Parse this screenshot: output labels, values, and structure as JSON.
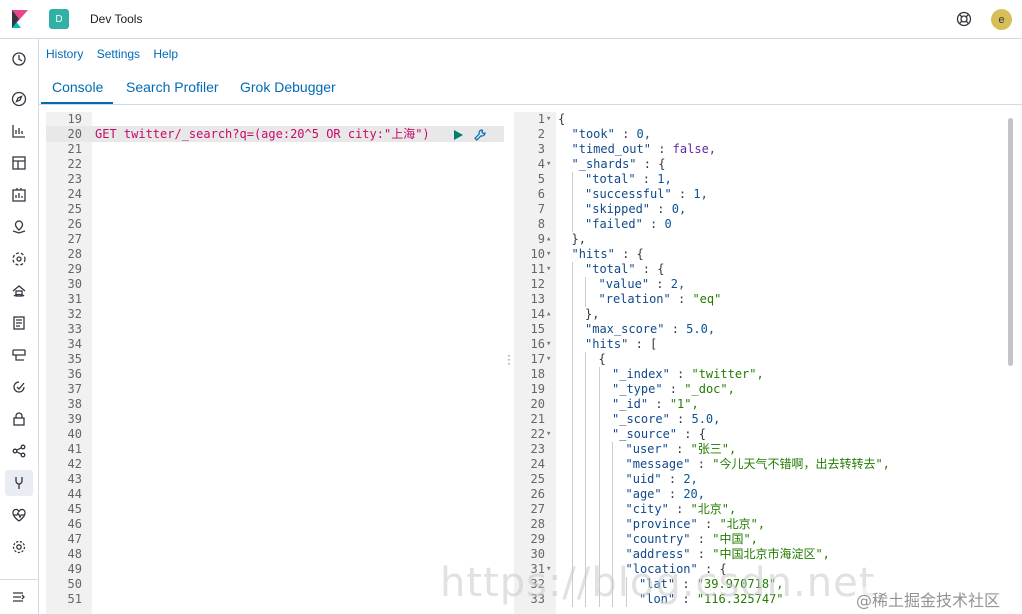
{
  "header": {
    "space_letter": "D",
    "app_title": "Dev Tools",
    "avatar_letter": "e"
  },
  "top_links": [
    "History",
    "Settings",
    "Help"
  ],
  "tabs": [
    {
      "label": "Console",
      "active": true
    },
    {
      "label": "Search Profiler",
      "active": false
    },
    {
      "label": "Grok Debugger",
      "active": false
    }
  ],
  "nav_icons": [
    "clock-icon",
    "compass-icon",
    "visualize-icon",
    "dashboard-icon",
    "canvas-icon",
    "maps-icon",
    "ml-icon",
    "infrastructure-icon",
    "logs-icon",
    "apm-icon",
    "uptime-icon",
    "siem-icon",
    "graph-icon",
    "devtools-icon",
    "monitoring-icon",
    "management-icon",
    "collapse-icon"
  ],
  "request_editor": {
    "line_numbers": [
      "19",
      "20",
      "21",
      "22",
      "23",
      "24",
      "25",
      "26",
      "27",
      "28",
      "29",
      "30",
      "31",
      "32",
      "33",
      "34",
      "35",
      "36",
      "37",
      "38",
      "39",
      "40",
      "41",
      "42",
      "43",
      "44",
      "45",
      "46",
      "47",
      "48",
      "49",
      "50",
      "51"
    ],
    "active_line": "GET twitter/_search?q=(age:20^5 OR city:\"上海\")"
  },
  "response_editor": {
    "lines": [
      {
        "n": "1",
        "fold": "▾",
        "indent": 0,
        "text": "{"
      },
      {
        "n": "2",
        "fold": "",
        "indent": 1,
        "text": "\"took\" : 0,"
      },
      {
        "n": "3",
        "fold": "",
        "indent": 1,
        "text": "\"timed_out\" : false,"
      },
      {
        "n": "4",
        "fold": "▾",
        "indent": 1,
        "text": "\"_shards\" : {"
      },
      {
        "n": "5",
        "fold": "",
        "indent": 2,
        "text": "\"total\" : 1,"
      },
      {
        "n": "6",
        "fold": "",
        "indent": 2,
        "text": "\"successful\" : 1,"
      },
      {
        "n": "7",
        "fold": "",
        "indent": 2,
        "text": "\"skipped\" : 0,"
      },
      {
        "n": "8",
        "fold": "",
        "indent": 2,
        "text": "\"failed\" : 0"
      },
      {
        "n": "9",
        "fold": "▴",
        "indent": 1,
        "text": "},"
      },
      {
        "n": "10",
        "fold": "▾",
        "indent": 1,
        "text": "\"hits\" : {"
      },
      {
        "n": "11",
        "fold": "▾",
        "indent": 2,
        "text": "\"total\" : {"
      },
      {
        "n": "12",
        "fold": "",
        "indent": 3,
        "text": "\"value\" : 2,"
      },
      {
        "n": "13",
        "fold": "",
        "indent": 3,
        "text": "\"relation\" : \"eq\""
      },
      {
        "n": "14",
        "fold": "▴",
        "indent": 2,
        "text": "},"
      },
      {
        "n": "15",
        "fold": "",
        "indent": 2,
        "text": "\"max_score\" : 5.0,"
      },
      {
        "n": "16",
        "fold": "▾",
        "indent": 2,
        "text": "\"hits\" : ["
      },
      {
        "n": "17",
        "fold": "▾",
        "indent": 3,
        "text": "{"
      },
      {
        "n": "18",
        "fold": "",
        "indent": 4,
        "text": "\"_index\" : \"twitter\","
      },
      {
        "n": "19",
        "fold": "",
        "indent": 4,
        "text": "\"_type\" : \"_doc\","
      },
      {
        "n": "20",
        "fold": "",
        "indent": 4,
        "text": "\"_id\" : \"1\","
      },
      {
        "n": "21",
        "fold": "",
        "indent": 4,
        "text": "\"_score\" : 5.0,"
      },
      {
        "n": "22",
        "fold": "▾",
        "indent": 4,
        "text": "\"_source\" : {"
      },
      {
        "n": "23",
        "fold": "",
        "indent": 5,
        "text": "\"user\" : \"张三\","
      },
      {
        "n": "24",
        "fold": "",
        "indent": 5,
        "text": "\"message\" : \"今儿天气不错啊，出去转转去\","
      },
      {
        "n": "25",
        "fold": "",
        "indent": 5,
        "text": "\"uid\" : 2,"
      },
      {
        "n": "26",
        "fold": "",
        "indent": 5,
        "text": "\"age\" : 20,"
      },
      {
        "n": "27",
        "fold": "",
        "indent": 5,
        "text": "\"city\" : \"北京\","
      },
      {
        "n": "28",
        "fold": "",
        "indent": 5,
        "text": "\"province\" : \"北京\","
      },
      {
        "n": "29",
        "fold": "",
        "indent": 5,
        "text": "\"country\" : \"中国\","
      },
      {
        "n": "30",
        "fold": "",
        "indent": 5,
        "text": "\"address\" : \"中国北京市海淀区\","
      },
      {
        "n": "31",
        "fold": "▾",
        "indent": 5,
        "text": "\"location\" : {"
      },
      {
        "n": "32",
        "fold": "",
        "indent": 6,
        "text": "\"lat\" : \"39.970718\","
      },
      {
        "n": "33",
        "fold": "",
        "indent": 6,
        "text": "\"lon\" : \"116.325747\""
      }
    ]
  },
  "watermark": "https://blog.csdn.net",
  "watermark_credit": "@稀土掘金技术社区"
}
